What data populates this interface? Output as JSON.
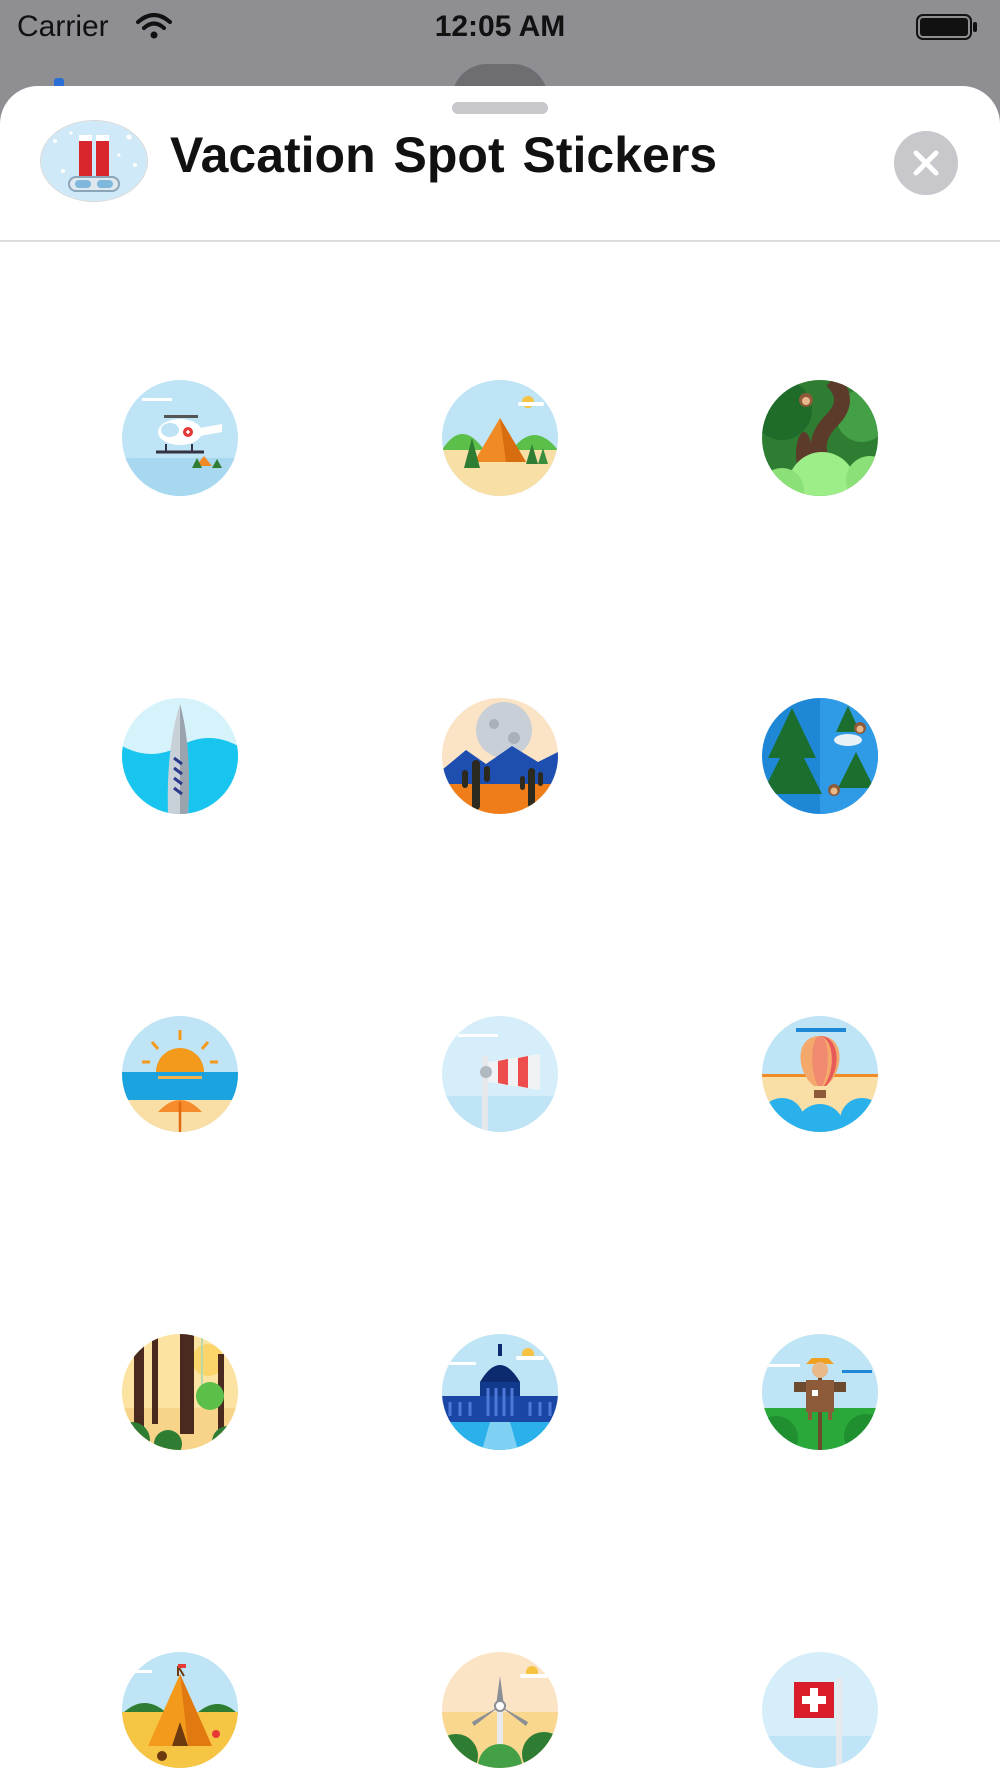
{
  "status_bar": {
    "carrier": "Carrier",
    "time": "12:05 AM"
  },
  "sheet": {
    "title": "Vacation Spot  Stickers",
    "app_icon": "ski-goggles-icon",
    "close_icon": "close-icon"
  },
  "stickers": [
    {
      "icon": "helicopter-icon"
    },
    {
      "icon": "camping-tent-icon"
    },
    {
      "icon": "jungle-monkey-icon"
    },
    {
      "icon": "surfboard-icon"
    },
    {
      "icon": "desert-cactus-icon"
    },
    {
      "icon": "forest-monkeys-icon"
    },
    {
      "icon": "beach-sunset-umbrella-icon"
    },
    {
      "icon": "windsock-icon"
    },
    {
      "icon": "hot-air-balloon-icon"
    },
    {
      "icon": "forest-trees-icon"
    },
    {
      "icon": "capitol-building-icon"
    },
    {
      "icon": "scarecrow-icon"
    },
    {
      "icon": "teepee-camp-icon"
    },
    {
      "icon": "windmill-icon"
    },
    {
      "icon": "swiss-flag-icon"
    }
  ]
}
